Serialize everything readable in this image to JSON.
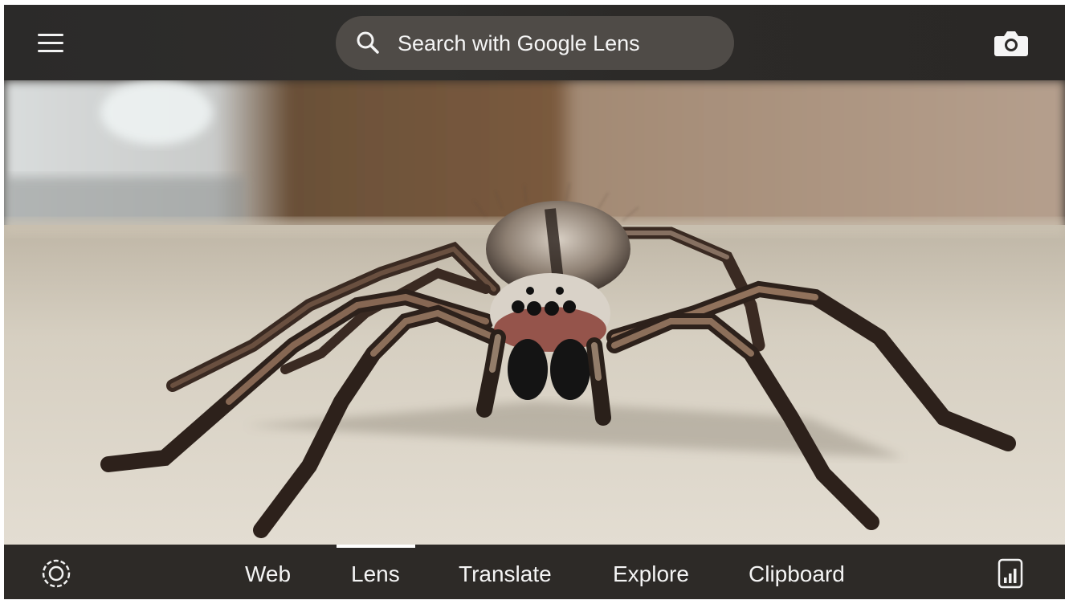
{
  "header": {
    "menu_icon": "hamburger-menu-icon",
    "search": {
      "placeholder": "Search with Google Lens",
      "icon": "search-icon"
    },
    "camera_icon": "camera-icon"
  },
  "main": {
    "image_subject": "spider"
  },
  "footer": {
    "lens_icon": "lens-capture-icon",
    "tabs": [
      {
        "label": "Web",
        "selected": false
      },
      {
        "label": "Lens",
        "selected": true
      },
      {
        "label": "Translate",
        "selected": false
      },
      {
        "label": "Explore",
        "selected": false
      },
      {
        "label": "Clipboard",
        "selected": false
      }
    ],
    "recent_icon": "recent-screenshot-icon"
  },
  "colors": {
    "bar_bg": "#2d2a27",
    "search_bg": "#4f4b47",
    "text": "#f4f4f4",
    "indicator": "#ffffff"
  }
}
